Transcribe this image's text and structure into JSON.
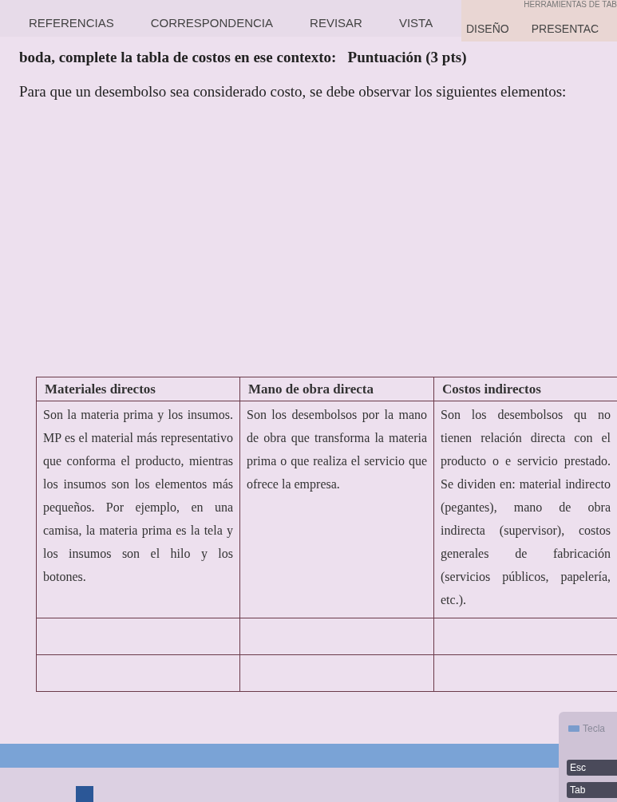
{
  "ribbon": {
    "context_label": "HERRAMIENTAS DE TAB",
    "tabs": [
      {
        "label": "REFERENCIAS",
        "contextual": false
      },
      {
        "label": "CORRESPONDENCIA",
        "contextual": false
      },
      {
        "label": "REVISAR",
        "contextual": false
      },
      {
        "label": "VISTA",
        "contextual": false
      },
      {
        "label": "DISEÑO",
        "contextual": true
      },
      {
        "label": "PRESENTAC",
        "contextual": true
      }
    ]
  },
  "document": {
    "instruction": "boda, complete la tabla de costos en ese contexto:   Puntuación (3 pts)",
    "paragraph": "Para que un desembolso sea considerado costo, se debe observar los siguientes elementos:",
    "table": {
      "columns": [
        "Materiales directos",
        "Mano de obra directa",
        "Costos indirectos"
      ],
      "rows": [
        [
          "Son la materia prima y los insumos. MP es el material más representativo que conforma el producto, mientras los insumos son los elementos más pequeños. Por ejemplo, en una camisa, la materia prima es la tela y los insumos son el hilo y los botones.",
          "Son los desembolsos por la mano de obra que transforma la materia prima o que realiza el servicio que ofrece la empresa.",
          "Son los desembolsos qu no tienen relación directa con el producto o e servicio prestado. Se dividen en: material indirecto (pegantes), mano de obra indirecta (supervisor), costos generales de fabricación (servicios públicos, papelería, etc.)."
        ]
      ]
    }
  },
  "keyboard": {
    "title": "Tecla",
    "keys": [
      "Esc",
      "Tab"
    ]
  }
}
